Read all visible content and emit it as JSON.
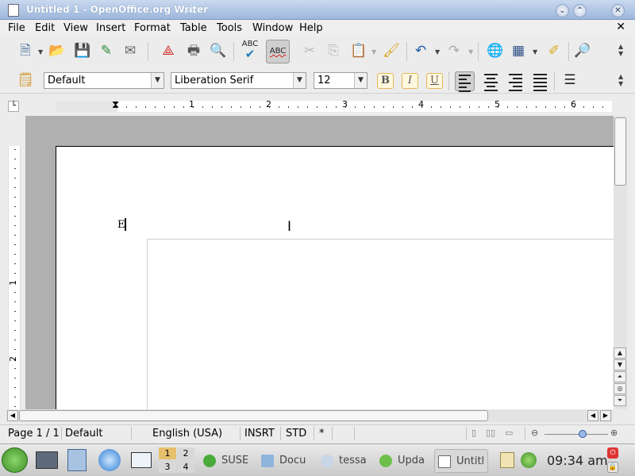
{
  "window": {
    "title": "Untitled 1 - OpenOffice.org Writer"
  },
  "menubar": {
    "items": [
      "File",
      "Edit",
      "View",
      "Insert",
      "Format",
      "Table",
      "Tools",
      "Window",
      "Help"
    ]
  },
  "formatting": {
    "paragraph_style": "Default",
    "font_name": "Liberation Serif",
    "font_size": "12",
    "bold_label": "B",
    "italic_label": "I",
    "underline_label": "U"
  },
  "ruler": {
    "ticks": [
      "1",
      "2",
      "3",
      "4",
      "5",
      "6"
    ]
  },
  "vruler": {
    "ticks": [
      "1",
      "2"
    ]
  },
  "document": {
    "text": "E"
  },
  "statusbar": {
    "page": "Page 1 / 1",
    "style": "Default",
    "language": "English (USA)",
    "insert_mode": "INSRT",
    "selection_mode": "STD",
    "modified": "*"
  },
  "taskbar": {
    "pager": [
      "1",
      "2",
      "3",
      "4"
    ],
    "tasks": [
      "SUSE",
      "Docu",
      "tessa",
      "Upda",
      "Untitl"
    ],
    "clock": "09:34 am"
  },
  "colors": {
    "titlebar": "#9db7dc",
    "accent": "#3a5f98",
    "taskbar": "#c9c9c9"
  },
  "icons": [
    "document-icon",
    "new-document-icon",
    "open-folder-icon",
    "save-icon",
    "edit-file-icon",
    "email-icon",
    "export-pdf-icon",
    "print-icon",
    "print-preview-icon",
    "spellcheck-icon",
    "autospellcheck-icon",
    "cut-icon",
    "copy-icon",
    "paste-icon",
    "clone-formatting-icon",
    "undo-icon",
    "redo-icon",
    "navigator-icon",
    "table-icon",
    "draw-functions-icon",
    "zoom-icon",
    "styles-icon",
    "bullets-icon"
  ]
}
